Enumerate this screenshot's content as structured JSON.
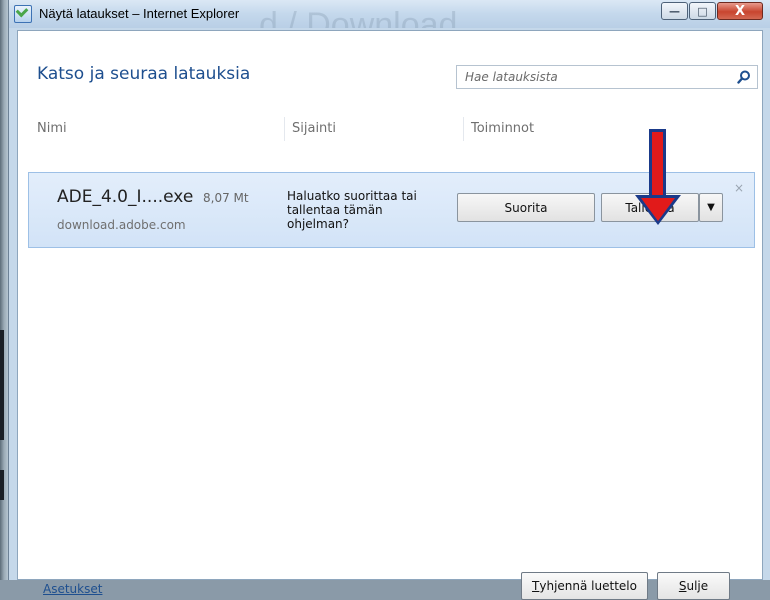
{
  "window": {
    "title": "Näytä lataukset – Internet Explorer",
    "watermark": "d / Download",
    "controls": {
      "minimize": "—",
      "maximize": "□",
      "close": "X"
    }
  },
  "header": {
    "title": "Katso ja seuraa latauksia",
    "search_placeholder": "Hae latauksista",
    "search_icon": "search-icon"
  },
  "columns": [
    "Nimi",
    "Sijainti",
    "Toiminnot"
  ],
  "download": {
    "file_name": "ADE_4.0_I....exe",
    "size": "8,07 Mt",
    "source": "download.adobe.com",
    "prompt": "Haluatko suorittaa tai tallentaa tämän ohjelman?",
    "run_label": "Suorita",
    "save_label": "Tallenna",
    "more_icon": "▼",
    "dismiss_icon": "×"
  },
  "footer": {
    "settings_link": "Asetukset",
    "clear_list_label": "Tyhjennä luettelo",
    "clear_list_accel": "T",
    "clear_list_rest": "yhjennä luettelo",
    "close_label": "Sulje",
    "close_accel": "S",
    "close_rest": "ulje"
  },
  "colors": {
    "accent": "#1e4f8f",
    "row_bg": "#d8e7f8",
    "annotation_arrow": "#e11a1a"
  }
}
